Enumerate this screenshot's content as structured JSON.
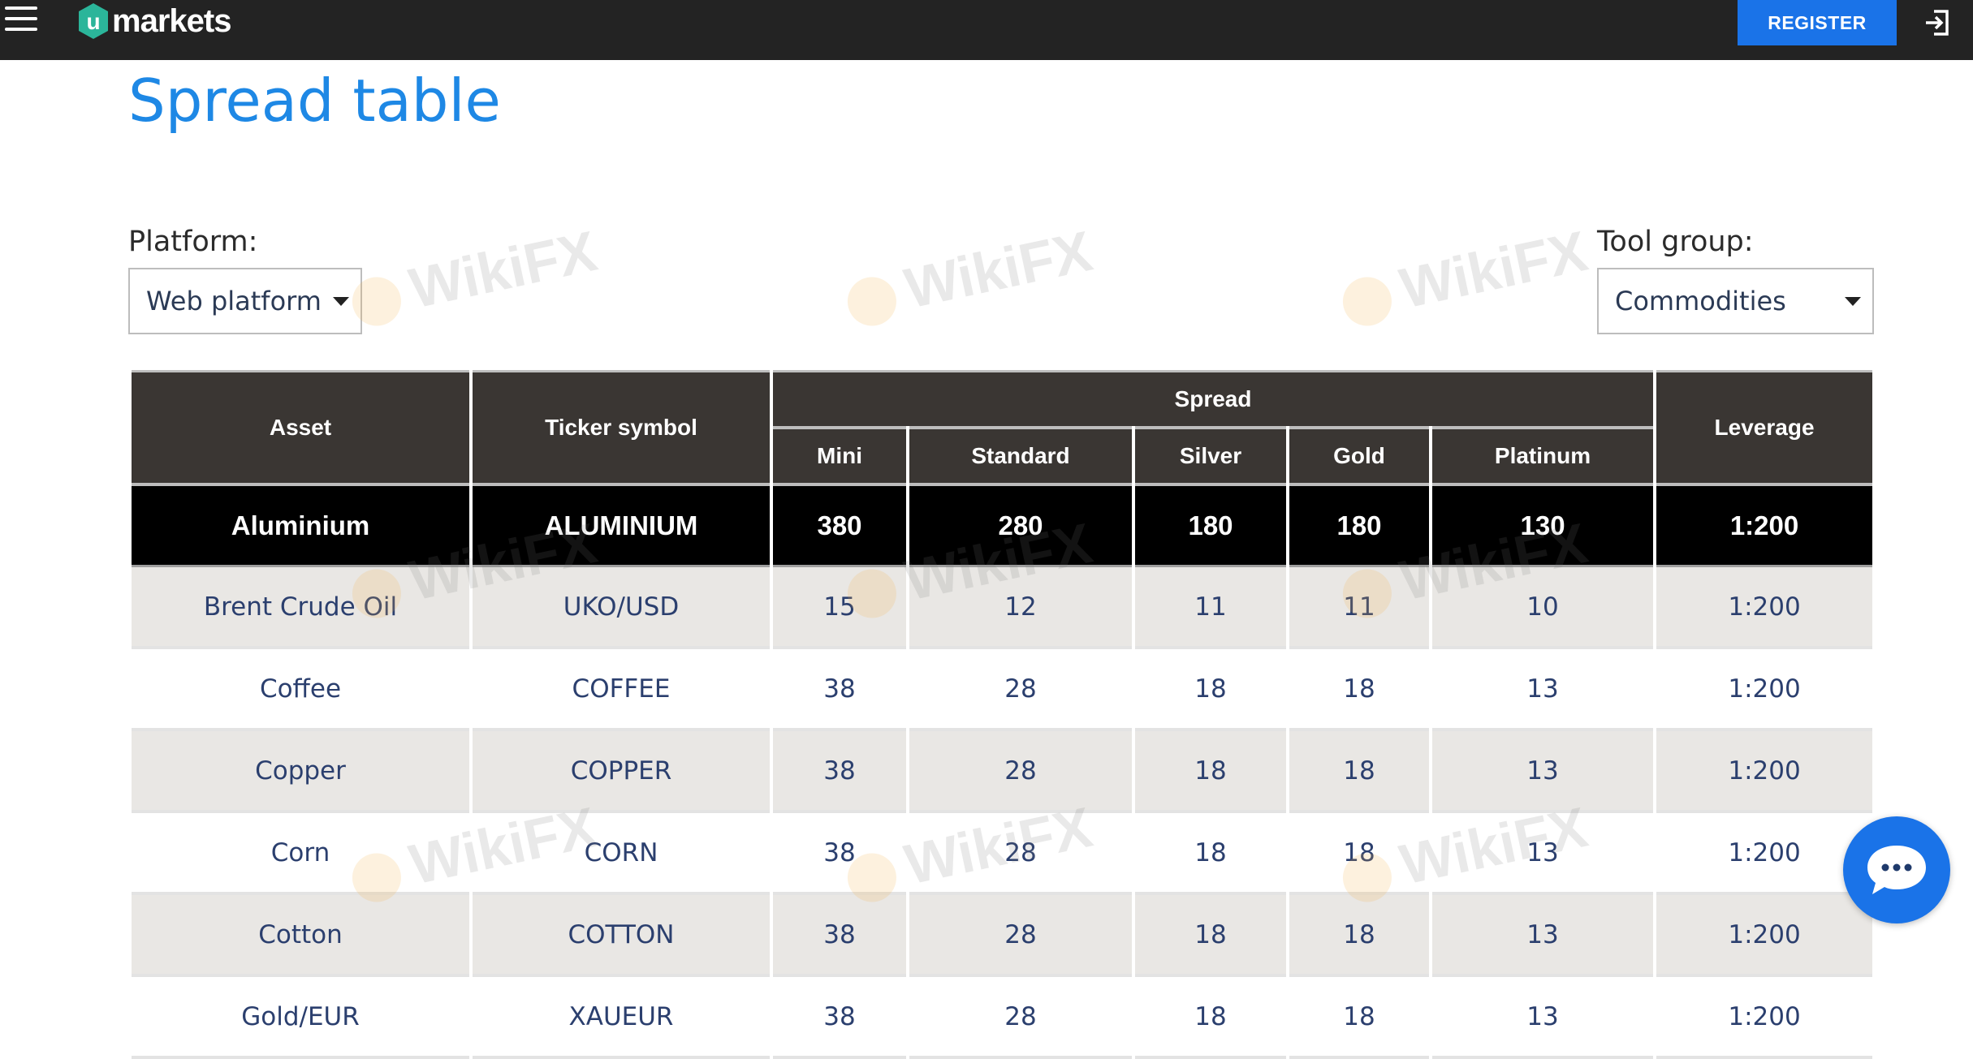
{
  "header": {
    "logo_letter": "u",
    "logo_text": "markets",
    "register_label": "REGISTER",
    "brand_color": "#1a73e8",
    "background": "#232323"
  },
  "page": {
    "title": "Spread table"
  },
  "filters": {
    "platform_label": "Platform:",
    "platform_value": "Web platform",
    "tool_group_label": "Tool group:",
    "tool_group_value": "Commodities"
  },
  "table": {
    "col_asset": "Asset",
    "col_ticker": "Ticker symbol",
    "col_spread": "Spread",
    "col_mini": "Mini",
    "col_standard": "Standard",
    "col_silver": "Silver",
    "col_gold": "Gold",
    "col_platinum": "Platinum",
    "col_leverage": "Leverage",
    "rows": [
      {
        "asset": "Aluminium",
        "ticker": "ALUMINIUM",
        "mini": "380",
        "standard": "280",
        "silver": "180",
        "gold": "180",
        "platinum": "130",
        "leverage": "1:200"
      },
      {
        "asset": "Brent Crude Oil",
        "ticker": "UKO/USD",
        "mini": "15",
        "standard": "12",
        "silver": "11",
        "gold": "11",
        "platinum": "10",
        "leverage": "1:200"
      },
      {
        "asset": "Coffee",
        "ticker": "COFFEE",
        "mini": "38",
        "standard": "28",
        "silver": "18",
        "gold": "18",
        "platinum": "13",
        "leverage": "1:200"
      },
      {
        "asset": "Copper",
        "ticker": "COPPER",
        "mini": "38",
        "standard": "28",
        "silver": "18",
        "gold": "18",
        "platinum": "13",
        "leverage": "1:200"
      },
      {
        "asset": "Corn",
        "ticker": "CORN",
        "mini": "38",
        "standard": "28",
        "silver": "18",
        "gold": "18",
        "platinum": "13",
        "leverage": "1:200"
      },
      {
        "asset": "Cotton",
        "ticker": "COTTON",
        "mini": "38",
        "standard": "28",
        "silver": "18",
        "gold": "18",
        "platinum": "13",
        "leverage": "1:200"
      },
      {
        "asset": "Gold/EUR",
        "ticker": "XAUEUR",
        "mini": "38",
        "standard": "28",
        "silver": "18",
        "gold": "18",
        "platinum": "13",
        "leverage": "1:200"
      }
    ]
  },
  "watermark": {
    "text": "WikiFX"
  },
  "icons": {
    "menu": "hamburger-menu-icon",
    "login": "login-icon",
    "chat": "chat-bubble-icon"
  }
}
